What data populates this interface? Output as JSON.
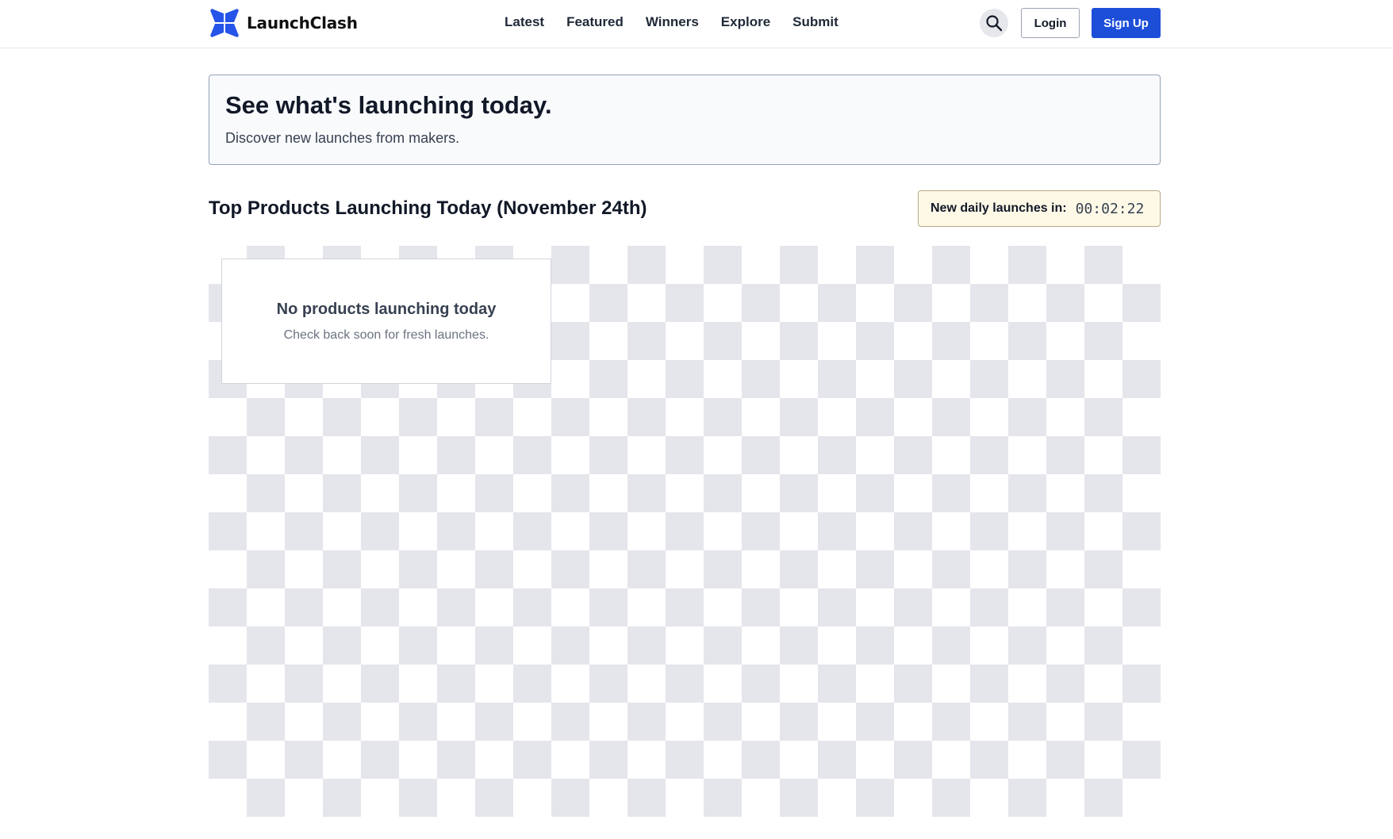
{
  "header": {
    "brand_name": "LaunchClash",
    "nav": [
      "Latest",
      "Featured",
      "Winners",
      "Explore",
      "Submit"
    ],
    "login_label": "Login",
    "signup_label": "Sign Up",
    "search_icon": "search-icon",
    "logo_icon": "launchclash-logo-icon",
    "accent_color": "#1d4ed8"
  },
  "hero": {
    "title": "See what's launching today.",
    "subtitle": "Discover new launches from makers."
  },
  "section": {
    "title": "Top Products Launching Today (November 24th)",
    "countdown_label": "New daily launches in:",
    "countdown_value": "00:02:22"
  },
  "empty_state": {
    "title": "No products launching today",
    "subtitle": "Check back soon for fresh launches."
  }
}
